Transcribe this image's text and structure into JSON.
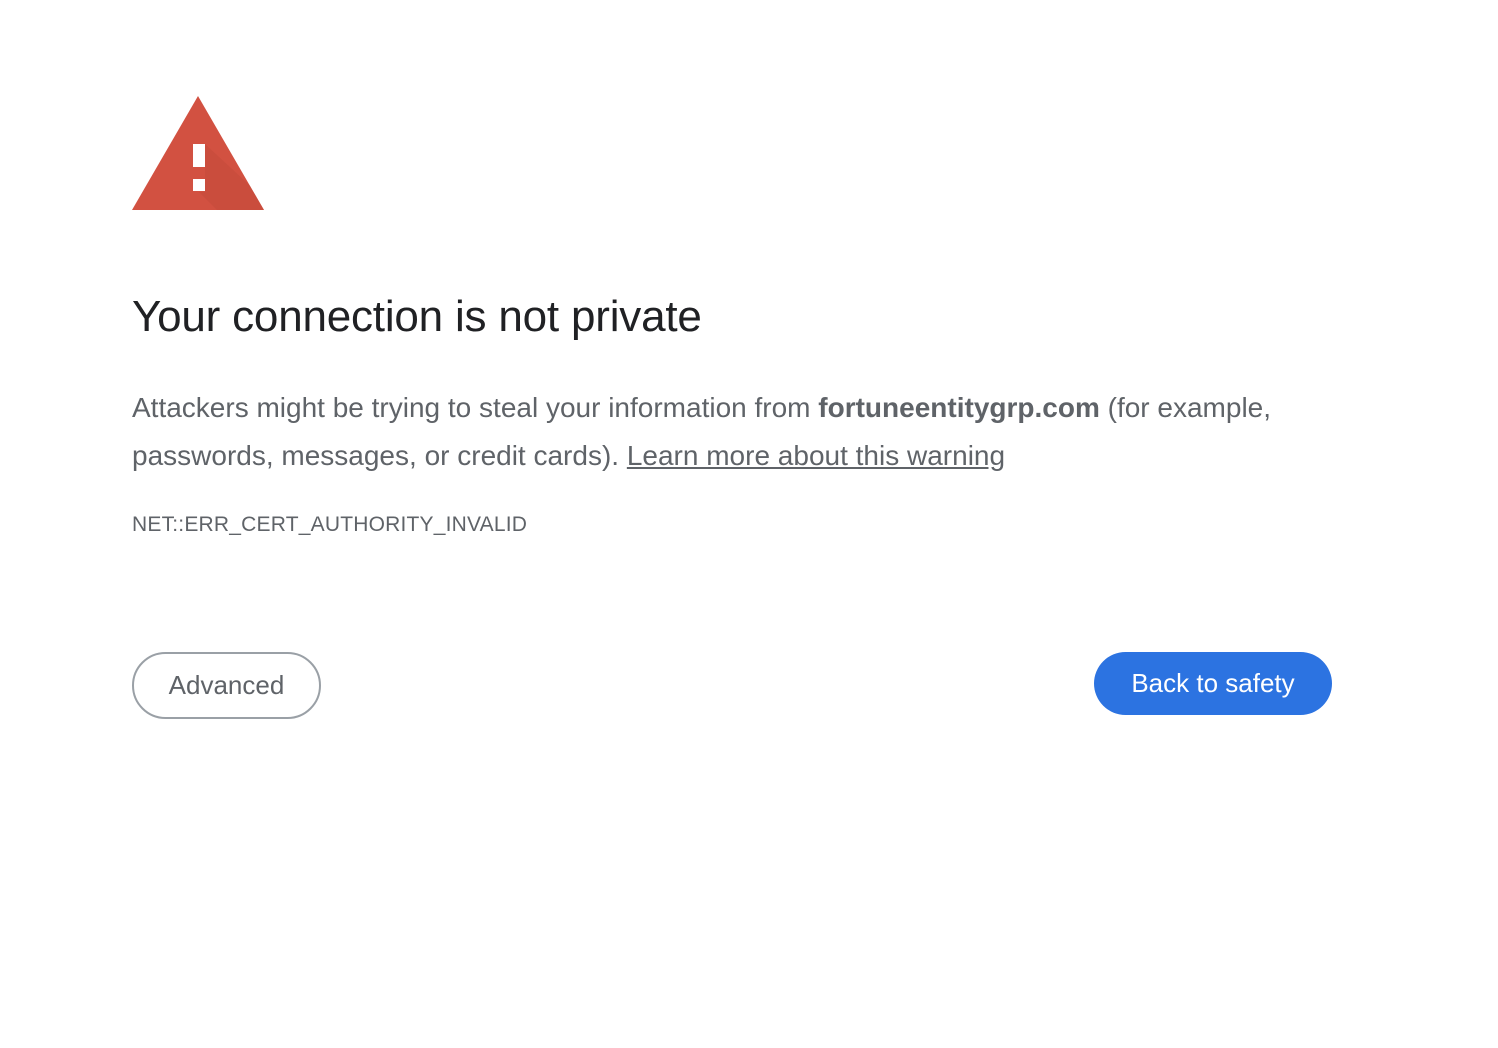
{
  "page": {
    "title": "Your connection is not private",
    "explanation_prefix": "Attackers might be trying to steal your information from ",
    "host": "fortuneentitygrp.com",
    "explanation_suffix": " (for example, passwords, messages, or credit cards). ",
    "learn_more_link": "Learn more about this warning",
    "error_code": "NET::ERR_CERT_AUTHORITY_INVALID"
  },
  "buttons": {
    "advanced_label": "Advanced",
    "back_label": "Back to safety"
  },
  "icons": {
    "warning": "warning-triangle-icon"
  },
  "colors": {
    "warning_red": "#d25141",
    "title_text": "#202124",
    "body_text": "#5f6368",
    "primary_button": "#2c73e1",
    "secondary_border": "#9aa0a6"
  }
}
